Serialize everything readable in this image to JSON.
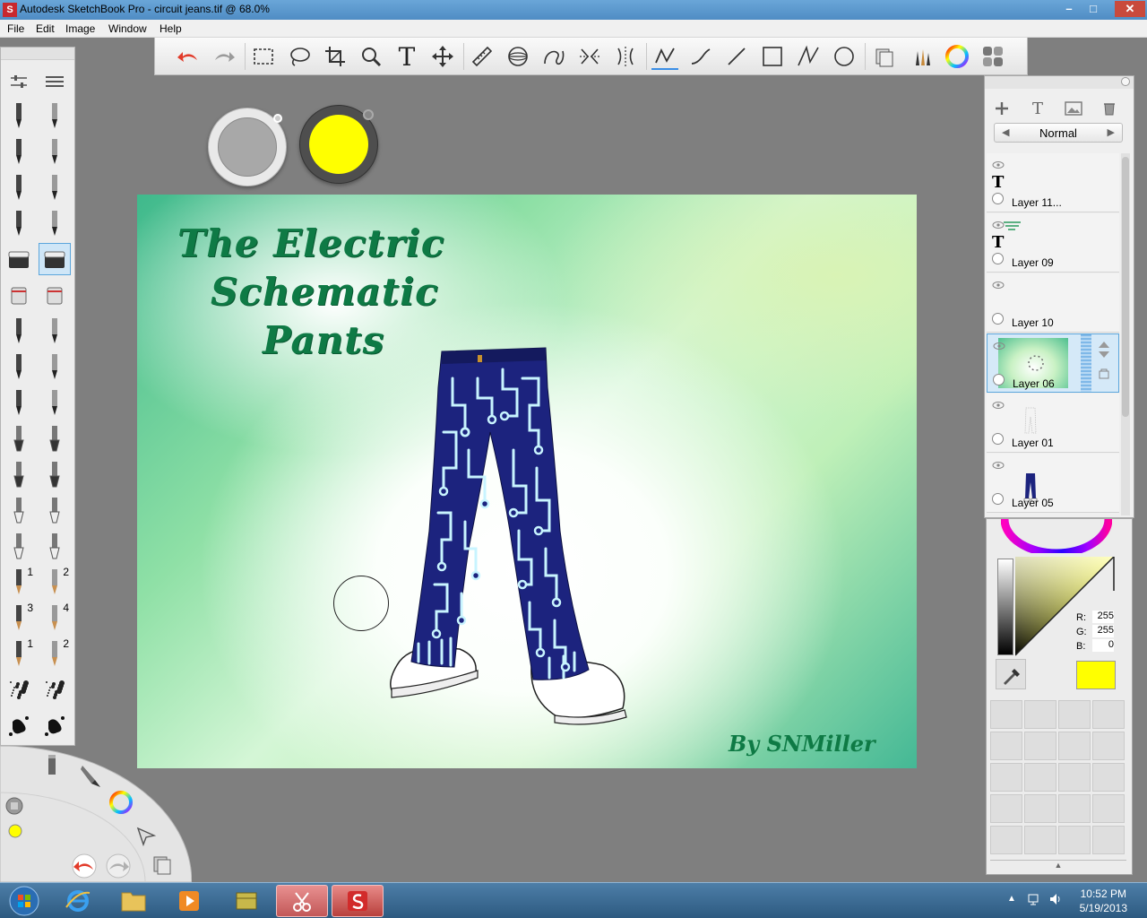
{
  "window": {
    "title": "Autodesk SketchBook Pro - circuit jeans.tif @ 68.0%",
    "minimize": "–",
    "maximize": "□",
    "close": "✕"
  },
  "menu": [
    "File",
    "Edit",
    "Image",
    "Window",
    "Help"
  ],
  "toolbar": {
    "tools": [
      "undo-icon",
      "redo-icon",
      "rect-select-icon",
      "lasso-icon",
      "crop-icon",
      "zoom-icon",
      "text-icon",
      "move-icon",
      "ruler-icon",
      "ellipse-guide-icon",
      "french-curve-icon",
      "symmetry-x-icon",
      "symmetry-y-icon",
      "brush-stroke-icon",
      "line-curve-icon",
      "line-icon",
      "rectangle-icon",
      "polyline-icon",
      "circle-icon",
      "layers-icon",
      "brush-palette-icon",
      "color-wheel-icon",
      "copic-palette-icon"
    ],
    "text_label": "T",
    "active": "brush-stroke-icon"
  },
  "brushes": {
    "numbers": [
      "1",
      "2",
      "3",
      "4",
      "1",
      "2"
    ]
  },
  "color_pucks": {
    "primary": "#a8a8a8",
    "secondary": "#ffff00"
  },
  "canvas": {
    "title_line1": "The Electric",
    "title_line2": "Schematic",
    "title_line3": "Pants",
    "signature": "By SNMiller",
    "title_color": "#0e7a45",
    "jeans_color": "#1c237e",
    "circuit_color": "#c8f4ff"
  },
  "layers": {
    "blend_mode": "Normal",
    "items": [
      {
        "name": "Layer 11...",
        "kind": "text"
      },
      {
        "name": "Layer 09",
        "kind": "text"
      },
      {
        "name": "Layer 10",
        "kind": "empty"
      },
      {
        "name": "Layer 06",
        "kind": "background",
        "selected": true
      },
      {
        "name": "Layer 01",
        "kind": "sketch"
      },
      {
        "name": "Layer 05",
        "kind": "jeans"
      }
    ]
  },
  "color_editor": {
    "r_label": "R:",
    "g_label": "G:",
    "b_label": "B:",
    "r": "255",
    "g": "255",
    "b": "0",
    "current": "#ffff00"
  },
  "taskbar": {
    "time": "10:52 PM",
    "date": "5/19/2013",
    "apps": [
      "start-orb-icon",
      "internet-explorer-icon",
      "file-explorer-icon",
      "media-player-icon",
      "archive-icon",
      "snipping-tool-icon",
      "sketchbook-icon"
    ]
  }
}
